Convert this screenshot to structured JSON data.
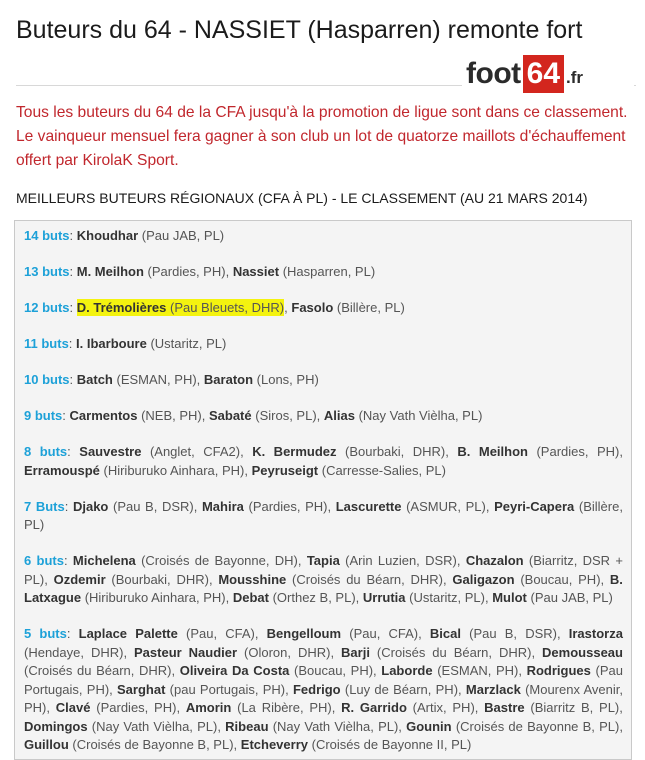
{
  "article": {
    "title": "Buteurs du 64 - NASSIET (Hasparren) remonte fort",
    "intro": "Tous les buteurs du 64 de la CFA jusqu'à la promotion de ligue sont dans ce classement. Le vainqueur mensuel fera gagner à son club un lot de quatorze maillots d'échauffement offert par KirolaK Sport.",
    "section_title": "MEILLEURS BUTEURS RÉGIONAUX (CFA À PL) - LE CLASSEMENT (AU 21 MARS 2014)"
  },
  "logo": {
    "word": "foot",
    "number": "64",
    "tld": ".fr"
  },
  "colors": {
    "accent_blue": "#1da1d8",
    "intro_red": "#c1272d",
    "highlight": "#f4f30f"
  },
  "ranking": [
    {
      "goals": "14 buts",
      "players": [
        {
          "name": "Khoudhar",
          "club": "(Pau JAB, PL)"
        }
      ]
    },
    {
      "goals": "13 buts",
      "players": [
        {
          "name": "M. Meilhon",
          "club": "(Pardies, PH)"
        },
        {
          "name": "Nassiet",
          "club": "(Hasparren, PL)"
        }
      ]
    },
    {
      "goals": "12 buts",
      "players": [
        {
          "name": "D. Trémolières",
          "club": "(Pau Bleuets, DHR)",
          "highlight": true
        },
        {
          "name": "Fasolo",
          "club": "(Billère, PL)"
        }
      ]
    },
    {
      "goals": "11 buts",
      "players": [
        {
          "name": "I. Ibarboure",
          "club": "(Ustaritz, PL)"
        }
      ]
    },
    {
      "goals": "10 buts",
      "players": [
        {
          "name": "Batch",
          "club": "(ESMAN, PH)"
        },
        {
          "name": "Baraton",
          "club": "(Lons, PH)"
        }
      ]
    },
    {
      "goals": "9 buts",
      "players": [
        {
          "name": "Carmentos",
          "club": "(NEB, PH)"
        },
        {
          "name": "Sabaté",
          "club": "(Siros, PL)"
        },
        {
          "name": "Alias",
          "club": "(Nay Vath Vièlha, PL)"
        }
      ]
    },
    {
      "goals": "8 buts",
      "players": [
        {
          "name": "Sauvestre",
          "club": "(Anglet, CFA2)"
        },
        {
          "name": "K. Bermudez",
          "club": "(Bourbaki, DHR)"
        },
        {
          "name": "B. Meilhon",
          "club": "(Pardies, PH)"
        },
        {
          "name": "Erramouspé",
          "club": "(Hiriburuko Ainhara, PH)"
        },
        {
          "name": "Peyruseigt",
          "club": "(Carresse-Salies, PL)"
        }
      ]
    },
    {
      "goals": "7 Buts",
      "players": [
        {
          "name": "Djako",
          "club": "(Pau B, DSR)"
        },
        {
          "name": "Mahira",
          "club": "(Pardies, PH)"
        },
        {
          "name": "Lascurette",
          "club": "(ASMUR, PL)"
        },
        {
          "name": "Peyri-Capera",
          "club": "(Billère, PL)"
        }
      ]
    },
    {
      "goals": "6 buts",
      "players": [
        {
          "name": "Michelena",
          "club": "(Croisés de Bayonne, DH)"
        },
        {
          "name": "Tapia",
          "club": "(Arin Luzien, DSR)"
        },
        {
          "name": "Chazalon",
          "club": "(Biarritz, DSR + PL)"
        },
        {
          "name": "Ozdemir",
          "club": "(Bourbaki, DHR)"
        },
        {
          "name": "Mousshine",
          "club": "(Croisés du Béarn, DHR)"
        },
        {
          "name": "Galigazon",
          "club": "(Boucau, PH)"
        },
        {
          "name": "B. Latxague",
          "club": "(Hiriburuko Ainhara, PH)"
        },
        {
          "name": "Debat",
          "club": "(Orthez B, PL)"
        },
        {
          "name": "Urrutia",
          "club": "(Ustaritz, PL)"
        },
        {
          "name": "Mulot",
          "club": "(Pau JAB, PL)"
        }
      ]
    },
    {
      "goals": "5 buts",
      "players": [
        {
          "name": "Laplace Palette",
          "club": "(Pau, CFA)"
        },
        {
          "name": "Bengelloum",
          "club": "(Pau, CFA)"
        },
        {
          "name": "Bical",
          "club": "(Pau B, DSR)"
        },
        {
          "name": "Irastorza",
          "club": "(Hendaye, DHR)"
        },
        {
          "name": "Pasteur Naudier",
          "club": "(Oloron, DHR)"
        },
        {
          "name": "Barji",
          "club": "(Croisés du Béarn, DHR)"
        },
        {
          "name": "Demousseau",
          "club": "(Croisés du Béarn, DHR)"
        },
        {
          "name": "Oliveira Da Costa",
          "club": "(Boucau, PH)"
        },
        {
          "name": "Laborde",
          "club": "(ESMAN, PH)"
        },
        {
          "name": "Rodrigues",
          "club": "(Pau Portugais, PH)"
        },
        {
          "name": "Sarghat",
          "club": "(pau Portugais, PH)"
        },
        {
          "name": "Fedrigo",
          "club": "(Luy de Béarn, PH)"
        },
        {
          "name": "Marzlack",
          "club": "(Mourenx Avenir, PH)"
        },
        {
          "name": "Clavé",
          "club": "(Pardies, PH)"
        },
        {
          "name": "Amorin",
          "club": "(La Ribère, PH)"
        },
        {
          "name": "R. Garrido",
          "club": "(Artix, PH)"
        },
        {
          "name": "Bastre",
          "club": "(Biarritz B, PL)"
        },
        {
          "name": "Domingos",
          "club": "(Nay Vath Vièlha, PL)"
        },
        {
          "name": "Ribeau",
          "club": "(Nay Vath Vièlha, PL)"
        },
        {
          "name": "Gounin",
          "club": "(Croisés de Bayonne B, PL)"
        },
        {
          "name": "Guillou",
          "club": "(Croisés de Bayonne B, PL)"
        },
        {
          "name": "Etcheverry",
          "club": "(Croisés de Bayonne II, PL)"
        }
      ]
    }
  ]
}
